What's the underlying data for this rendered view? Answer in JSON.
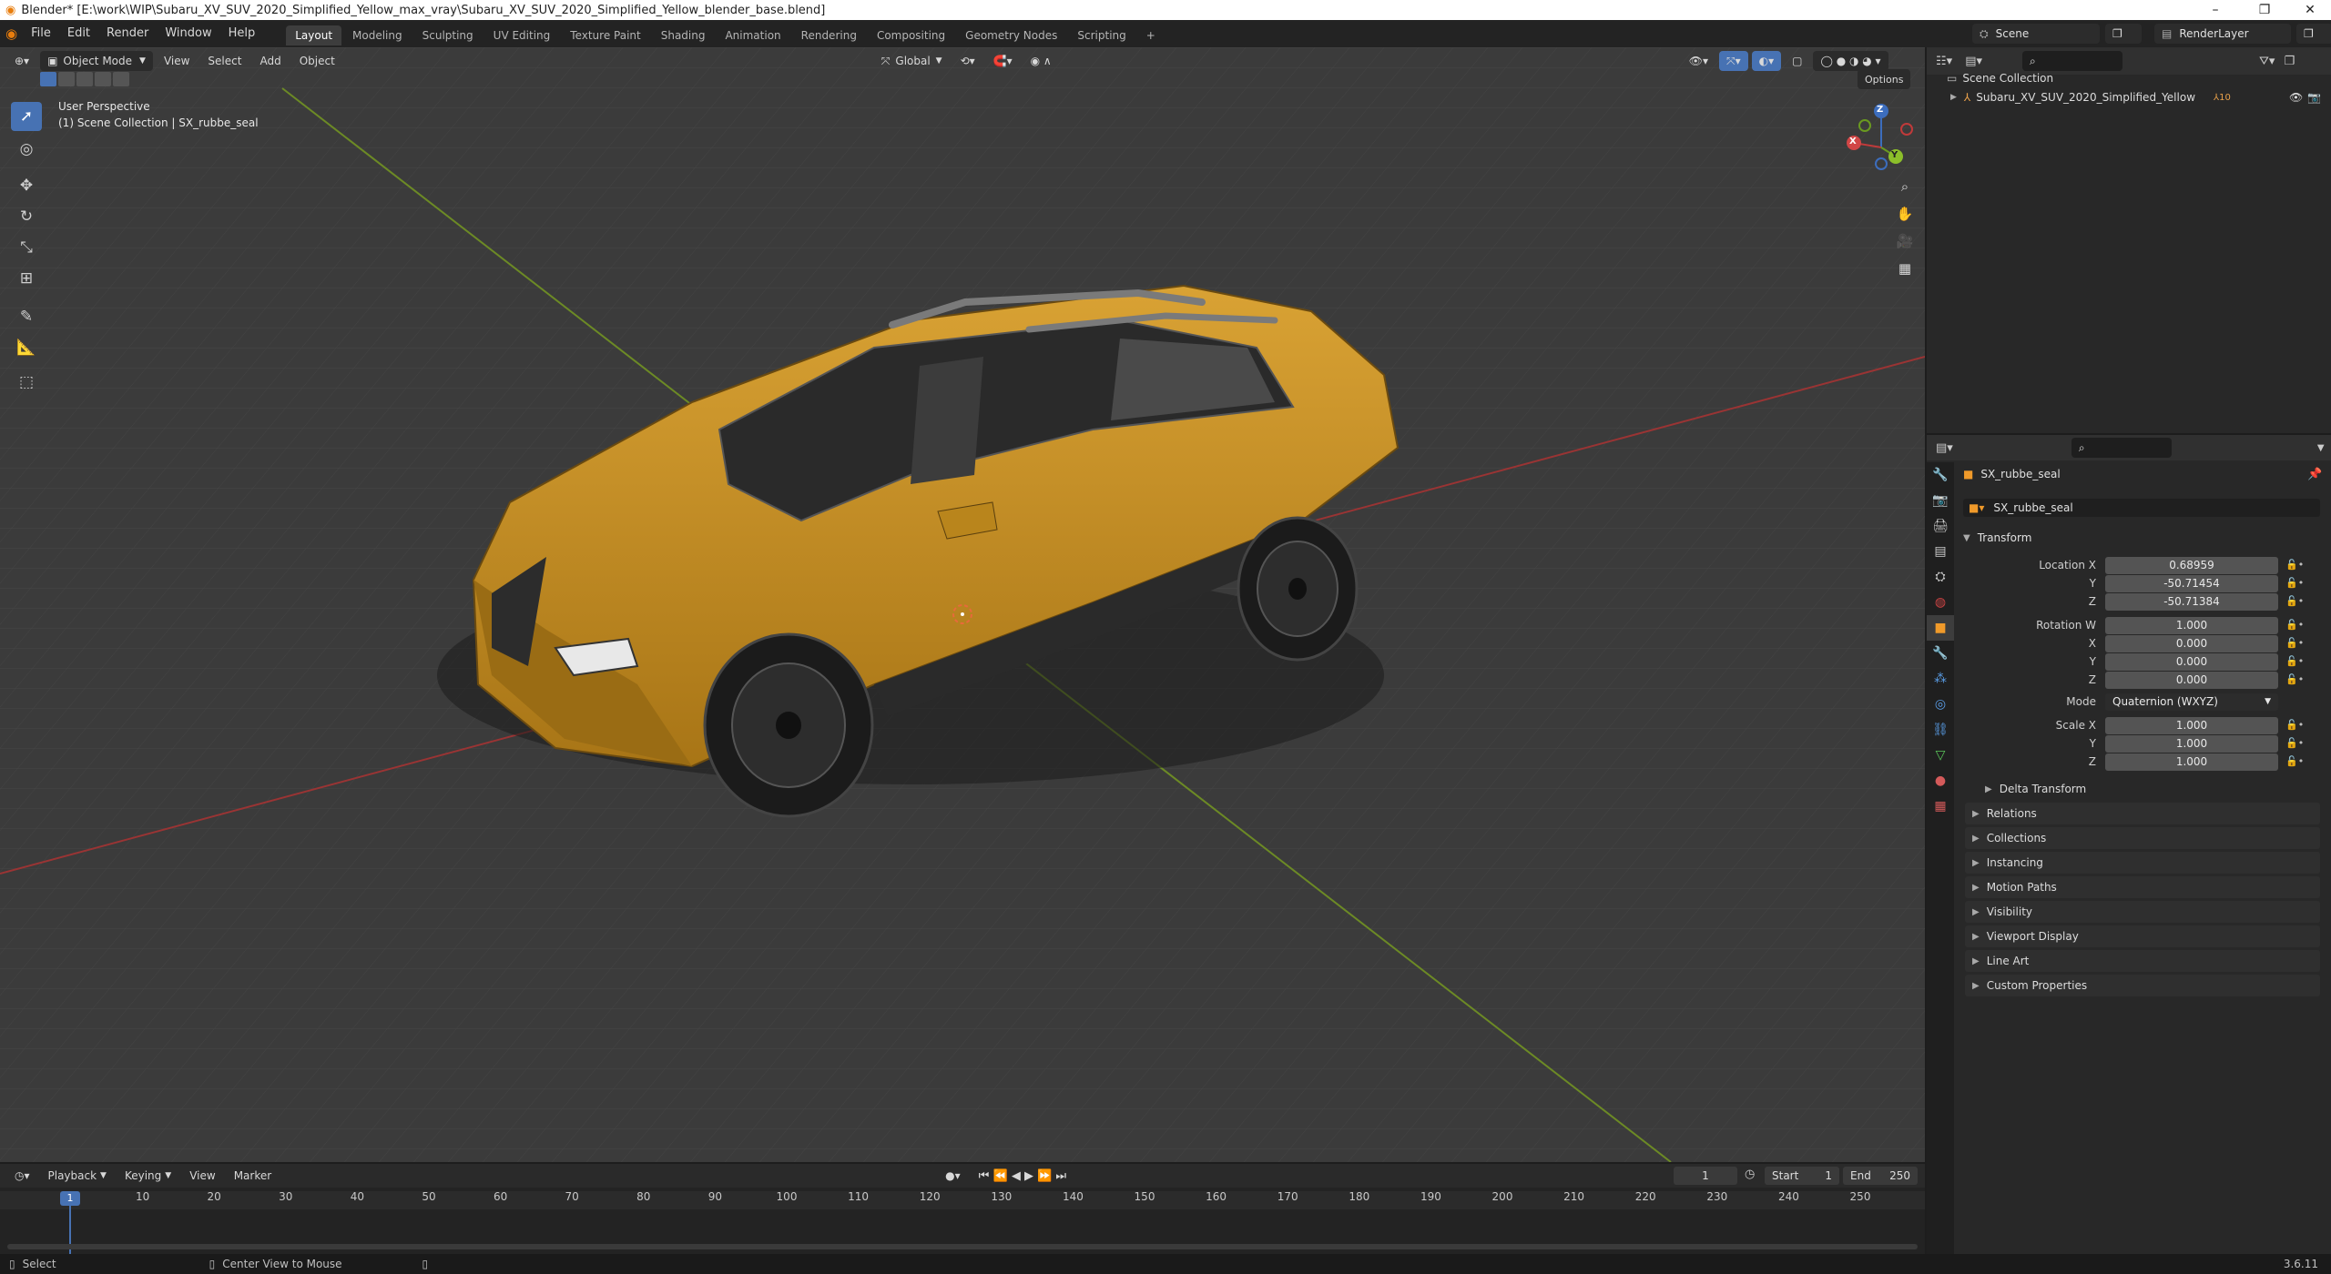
{
  "title_bar": {
    "text": "Blender* [E:\\work\\WIP\\Subaru_XV_SUV_2020_Simplified_Yellow_max_vray\\Subaru_XV_SUV_2020_Simplified_Yellow_blender_base.blend]",
    "minimize": "–",
    "maximize": "❐",
    "close": "✕"
  },
  "menu": [
    "File",
    "Edit",
    "Render",
    "Window",
    "Help"
  ],
  "workspaces": [
    "Layout",
    "Modeling",
    "Sculpting",
    "UV Editing",
    "Texture Paint",
    "Shading",
    "Animation",
    "Rendering",
    "Compositing",
    "Geometry Nodes",
    "Scripting"
  ],
  "add_workspace": "+",
  "scene_name": "Scene",
  "render_layer": "RenderLayer",
  "viewport": {
    "mode": "Object Mode",
    "menus": [
      "View",
      "Select",
      "Add",
      "Object"
    ],
    "orientation": "Global",
    "options_label": "Options",
    "perspective_label": "User Perspective",
    "collection_label": "(1) Scene Collection | SX_rubbe_seal",
    "gizmo": {
      "x": "X",
      "y": "Y",
      "z": "Z"
    }
  },
  "outliner": {
    "root": "Scene Collection",
    "items": [
      {
        "label": "Subaru_XV_SUV_2020_Simplified_Yellow",
        "badge": "10"
      }
    ]
  },
  "properties": {
    "object_name": "SX_rubbe_seal",
    "data_name": "SX_rubbe_seal",
    "transform_label": "Transform",
    "location_label": "Location X",
    "location": {
      "x": "0.68959",
      "y": "-50.71454",
      "z": "-50.71384"
    },
    "rotation_label": "Rotation W",
    "rotation": {
      "w": "1.000",
      "x": "0.000",
      "y": "0.000",
      "z": "0.000"
    },
    "mode_label": "Mode",
    "mode_value": "Quaternion (WXYZ)",
    "scale_label": "Scale X",
    "scale": {
      "x": "1.000",
      "y": "1.000",
      "z": "1.000"
    },
    "axis_labels": {
      "x": "X",
      "y": "Y",
      "z": "Z"
    },
    "delta_transform": "Delta Transform",
    "panels": [
      "Relations",
      "Collections",
      "Instancing",
      "Motion Paths",
      "Visibility",
      "Viewport Display",
      "Line Art",
      "Custom Properties"
    ]
  },
  "timeline": {
    "menus": [
      "Playback",
      "Keying",
      "View",
      "Marker"
    ],
    "current_frame": "1",
    "start_label": "Start",
    "start_value": "1",
    "end_label": "End",
    "end_value": "250",
    "ticks": [
      "10",
      "20",
      "30",
      "40",
      "50",
      "60",
      "70",
      "80",
      "90",
      "100",
      "110",
      "120",
      "130",
      "140",
      "150",
      "160",
      "170",
      "180",
      "190",
      "200",
      "210",
      "220",
      "230",
      "240",
      "250"
    ]
  },
  "statusbar": {
    "select": "Select",
    "center_view": "Center View to Mouse",
    "version": "3.6.11"
  },
  "colors": {
    "car_body": "#c8921c",
    "accent_blue": "#4772b3",
    "axis_red": "#c03a3a",
    "axis_green": "#6a8f2a"
  }
}
